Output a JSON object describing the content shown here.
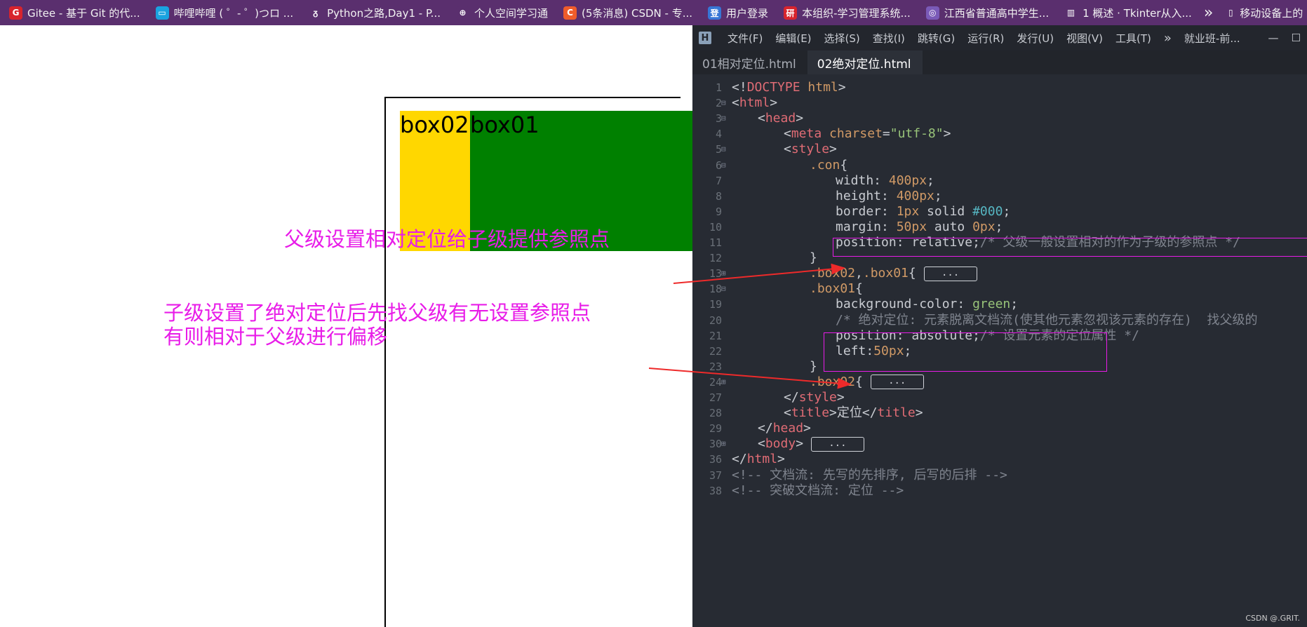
{
  "bookmarks": [
    {
      "icon": "gitee-icon",
      "icon_text": "G",
      "color": "#d8242d",
      "label": "Gitee - 基于 Git 的代..."
    },
    {
      "icon": "bilibili-icon",
      "icon_text": "▭",
      "color": "#1aa3e0",
      "label": "哔哩哔哩 ( ゜- ゜)つロ ..."
    },
    {
      "icon": "python-icon",
      "icon_text": "ᵹ",
      "color": "#5a2f6e",
      "label": "Python之路,Day1 - P..."
    },
    {
      "icon": "globe-icon",
      "icon_text": "⊕",
      "color": "#5a2f6e",
      "label": "个人空间学习通"
    },
    {
      "icon": "csdn-icon",
      "icon_text": "C",
      "color": "#ef5c2b",
      "label": "(5条消息) CSDN - 专..."
    },
    {
      "icon": "login-icon",
      "icon_text": "登",
      "color": "#3776d6",
      "label": "用户登录"
    },
    {
      "icon": "org-icon",
      "icon_text": "研",
      "color": "#d8242d",
      "label": "本组织-学习管理系统..."
    },
    {
      "icon": "school-icon",
      "icon_text": "◎",
      "color": "#7a5ab8",
      "label": "江西省普通高中学生..."
    },
    {
      "icon": "book-icon",
      "icon_text": "▥",
      "color": "#5a2f6e",
      "label": "1 概述 · Tkinter从入..."
    }
  ],
  "bookmarks_more": "»",
  "bookmarks_mobile": "移动设备上的",
  "page": {
    "box02": "box02",
    "box01": "box01",
    "note1": "父级设置相对定位给子级提供参照点",
    "note2_line1": "子级设置了绝对定位后先找父级有无设置参照点",
    "note2_line2": "有则相对于父级进行偏移"
  },
  "editor": {
    "menus": [
      "文件(F)",
      "编辑(E)",
      "选择(S)",
      "查找(I)",
      "跳转(G)",
      "运行(R)",
      "发行(U)",
      "视图(V)",
      "工具(T)"
    ],
    "menu_more": "»",
    "project": "就业班-前...",
    "tabs": [
      "01相对定位.html",
      "02绝对定位.html"
    ],
    "active_tab": 1,
    "line_numbers": [
      "1",
      "2",
      "3",
      "4",
      "5",
      "6",
      "7",
      "8",
      "9",
      "10",
      "11",
      "12",
      "13",
      "18",
      "19",
      "20",
      "21",
      "22",
      "23",
      "24",
      "27",
      "28",
      "29",
      "30",
      "36",
      "37",
      "38"
    ],
    "collapsed_label": "...",
    "watermark": "CSDN @.GRIT."
  }
}
